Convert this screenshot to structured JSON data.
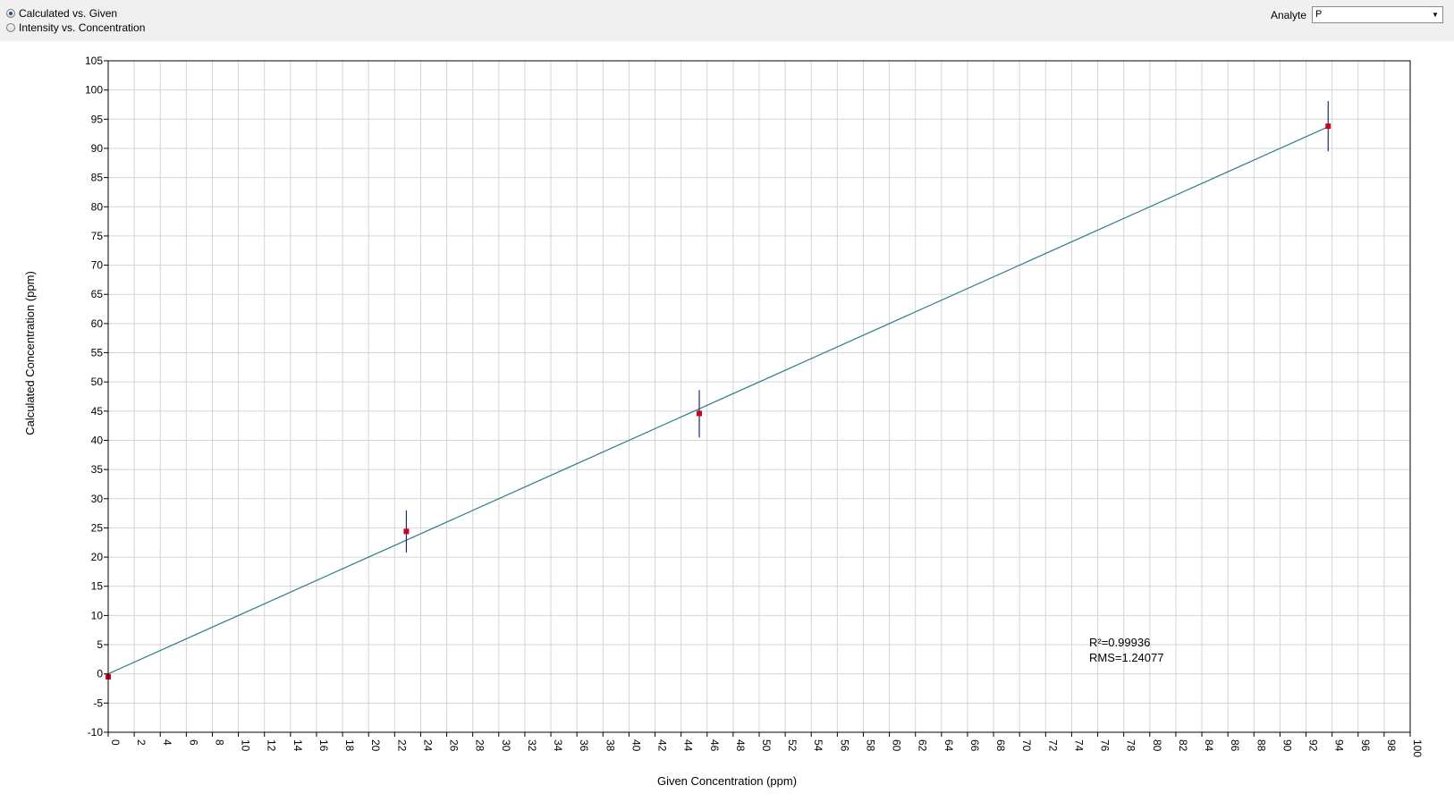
{
  "toolbar": {
    "modes": [
      {
        "label": "Calculated vs. Given",
        "checked": true
      },
      {
        "label": "Intensity vs. Concentration",
        "checked": false
      }
    ],
    "analyte_label": "Analyte",
    "analyte_value": "P"
  },
  "chart_data": {
    "type": "scatter",
    "xlabel": "Given Concentration (ppm)",
    "ylabel": "Calculated Concentration (ppm)",
    "xlim": [
      0,
      100
    ],
    "ylim": [
      -10,
      105
    ],
    "x_tick_step": 2,
    "y_tick_step": 5,
    "grid": true,
    "points": [
      {
        "x": 0,
        "y": -0.5,
        "err_low": -0.5,
        "err_high": -0.5
      },
      {
        "x": 22.9,
        "y": 24.4,
        "err_low": 20.8,
        "err_high": 28.0
      },
      {
        "x": 45.4,
        "y": 44.6,
        "err_low": 40.5,
        "err_high": 48.6
      },
      {
        "x": 93.7,
        "y": 93.8,
        "err_low": 89.5,
        "err_high": 98.1
      }
    ],
    "fit_line": {
      "x": [
        0,
        93.7
      ],
      "y": [
        0,
        93.7
      ]
    },
    "stats": {
      "r2": "R²=0.99936",
      "rms": "RMS=1.24077"
    },
    "colors": {
      "points": "#cc0022",
      "error_bars": "#1c2a6e",
      "fit": "#2e7a88",
      "grid": "#d4d4d4"
    }
  }
}
